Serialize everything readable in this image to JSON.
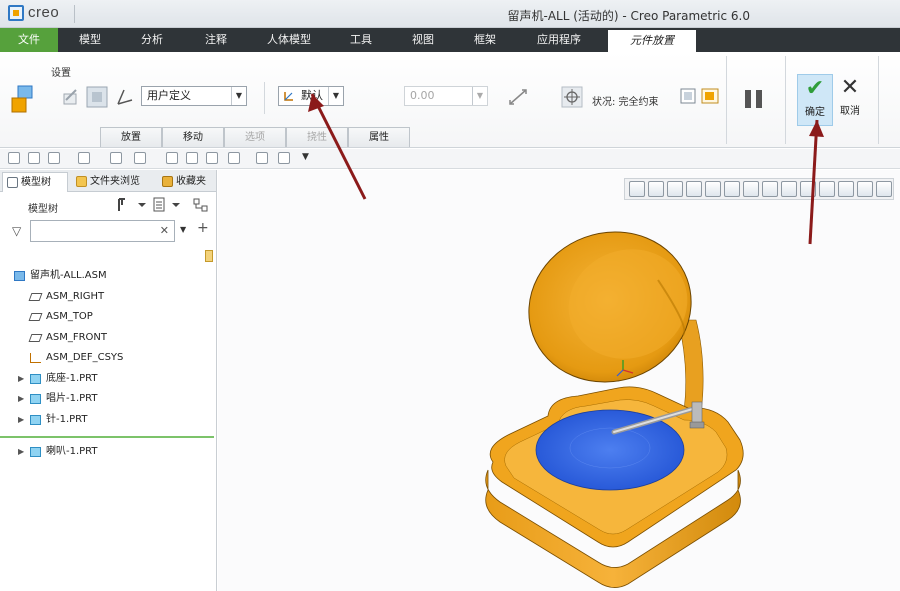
{
  "app": {
    "logo_text": "creo",
    "window_title": "留声机-ALL (活动的) - Creo Parametric 6.0"
  },
  "tabs": [
    {
      "label": "文件"
    },
    {
      "label": "模型"
    },
    {
      "label": "分析"
    },
    {
      "label": "注释"
    },
    {
      "label": "人体模型"
    },
    {
      "label": "工具"
    },
    {
      "label": "视图"
    },
    {
      "label": "框架"
    },
    {
      "label": "应用程序"
    },
    {
      "label": "元件放置"
    }
  ],
  "ribbon": {
    "group_label": "设置",
    "constraint_combo": "用户定义",
    "constraint_type": "默认",
    "offset_value": "0.00",
    "status_text": "状况: 完全约束",
    "ok_label": "确定",
    "cancel_label": "取消",
    "subtabs": [
      {
        "label": "放置",
        "enabled": true
      },
      {
        "label": "移动",
        "enabled": true
      },
      {
        "label": "选项",
        "enabled": false
      },
      {
        "label": "挠性",
        "enabled": false
      },
      {
        "label": "属性",
        "enabled": true
      }
    ]
  },
  "panel": {
    "tabs": [
      {
        "label": "模型树"
      },
      {
        "label": "文件夹浏览"
      },
      {
        "label": "收藏夹"
      }
    ],
    "tree_header": "模型树",
    "search_value": "",
    "tree": [
      {
        "label": "留声机-ALL.ASM",
        "type": "asm",
        "indent": 0,
        "expandable": false
      },
      {
        "label": "ASM_RIGHT",
        "type": "plane",
        "indent": 1,
        "expandable": false
      },
      {
        "label": "ASM_TOP",
        "type": "plane",
        "indent": 1,
        "expandable": false
      },
      {
        "label": "ASM_FRONT",
        "type": "plane",
        "indent": 1,
        "expandable": false
      },
      {
        "label": "ASM_DEF_CSYS",
        "type": "csys",
        "indent": 1,
        "expandable": false
      },
      {
        "label": "底座-1.PRT",
        "type": "part",
        "indent": 1,
        "expandable": true
      },
      {
        "label": "唱片-1.PRT",
        "type": "part",
        "indent": 1,
        "expandable": true
      },
      {
        "label": "针-1.PRT",
        "type": "part",
        "indent": 1,
        "expandable": true
      },
      {
        "label": "喇叭-1.PRT",
        "type": "part",
        "indent": 1,
        "expandable": true
      }
    ]
  },
  "colors": {
    "tab_bar": "#2f3438",
    "file_tab": "#56a13c",
    "ok_button": "#cfe7f7",
    "model_body": "#f0a51e",
    "turntable": "#2f63e0",
    "annotation_arrow": "#8b1a1a"
  }
}
